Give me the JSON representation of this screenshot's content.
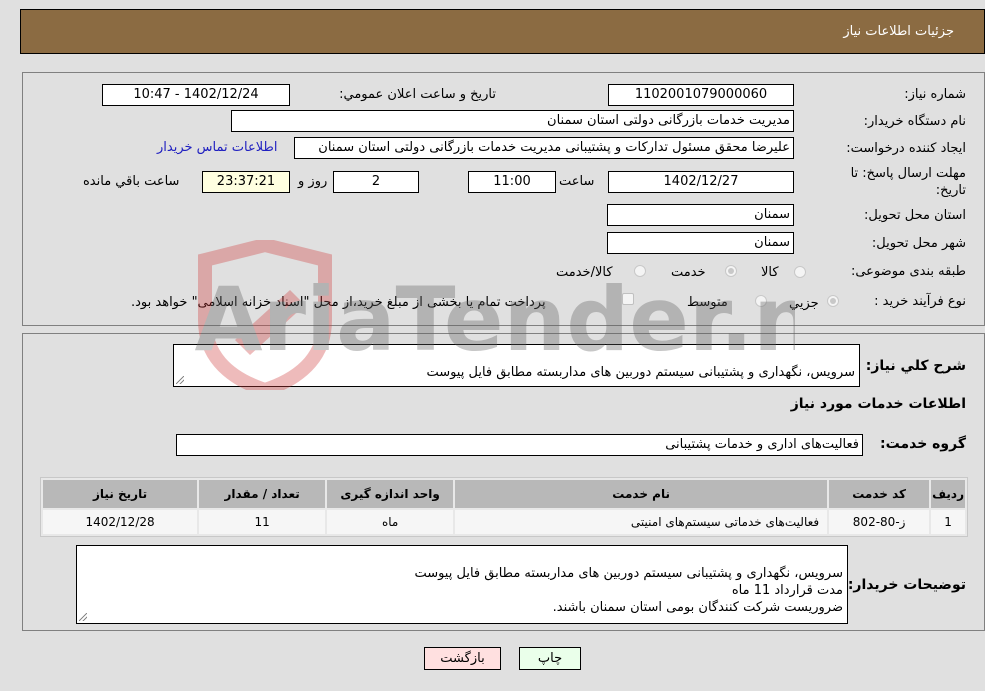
{
  "header": {
    "title": "جزئیات اطلاعات نیاز"
  },
  "form": {
    "need_number_label": "شماره نیاز:",
    "need_number": "1102001079000060",
    "announce_label": "تاریخ و ساعت اعلان عمومي:",
    "announce_value": "1402/12/24 - 10:47",
    "buyer_org_label": "نام دستگاه خریدار:",
    "buyer_org": "مدیریت خدمات بازرگانی دولتی استان سمنان",
    "creator_label": "ایجاد کننده درخواست:",
    "creator": "علیرضا محقق مسئول تدارکات و پشتیبانی مدیریت خدمات بازرگانی دولتی استان سمنان",
    "contact_link": "اطلاعات تماس خریدار",
    "deadline_label": "مهلت ارسال پاسخ: تا تاریخ:",
    "deadline_date": "1402/12/27",
    "time_label": "ساعت",
    "deadline_time": "11:00",
    "days_value": "2",
    "days_label": "روز و",
    "remaining_value": "23:37:21",
    "remaining_label": "ساعت باقي مانده",
    "province_label": "استان محل تحویل:",
    "province": "سمنان",
    "city_label": "شهر محل تحویل:",
    "city": "سمنان",
    "category_label": "طبقه بندی موضوعی:",
    "category_options": [
      {
        "label": "کالا",
        "checked": false
      },
      {
        "label": "خدمت",
        "checked": true
      },
      {
        "label": "کالا/خدمت",
        "checked": false
      }
    ],
    "process_label": "نوع فرآیند خرید :",
    "process_options": [
      {
        "label": "جزیي",
        "checked": true
      },
      {
        "label": "متوسط",
        "checked": false
      }
    ],
    "treasury_note": "پرداخت تمام یا بخشی از مبلغ خرید،از محل \"اسناد خزانه اسلامی\" خواهد بود."
  },
  "details": {
    "description_label": "شرح کلي نیاز:",
    "description": "سرویس، نگهداری و پشتیبانی سیستم دوربین های مداربسته مطابق فایل پیوست",
    "services_heading": "اطلاعات خدمات مورد نیاز",
    "service_group_label": "گروه خدمت:",
    "service_group": "فعالیت‌های اداری و خدمات پشتیبانی",
    "table": {
      "headers": [
        "ردیف",
        "کد خدمت",
        "نام خدمت",
        "واحد اندازه گیری",
        "تعداد / مقدار",
        "تاریخ نیاز"
      ],
      "rows": [
        [
          "1",
          "ز-80-802",
          "فعالیت‌های خدماتی سیستم‌های امنیتی",
          "ماه",
          "11",
          "1402/12/28"
        ]
      ]
    },
    "buyer_notes_label": "توضیحات خریدار:",
    "buyer_notes": "سرویس، نگهداری و پشتیبانی سیستم دوربین های مداربسته مطابق فایل پیوست\nمدت قرارداد 11 ماه\nضروریست شرکت کنندگان بومی استان سمنان باشند."
  },
  "buttons": {
    "print": "چاپ",
    "back": "بازگشت"
  },
  "watermark": {
    "text": "AriaTender.neT"
  },
  "colors": {
    "header_bg": "#8b6b42",
    "link": "#2020c0",
    "print_bg": "#eaffea",
    "back_bg": "#ffe0e0"
  }
}
